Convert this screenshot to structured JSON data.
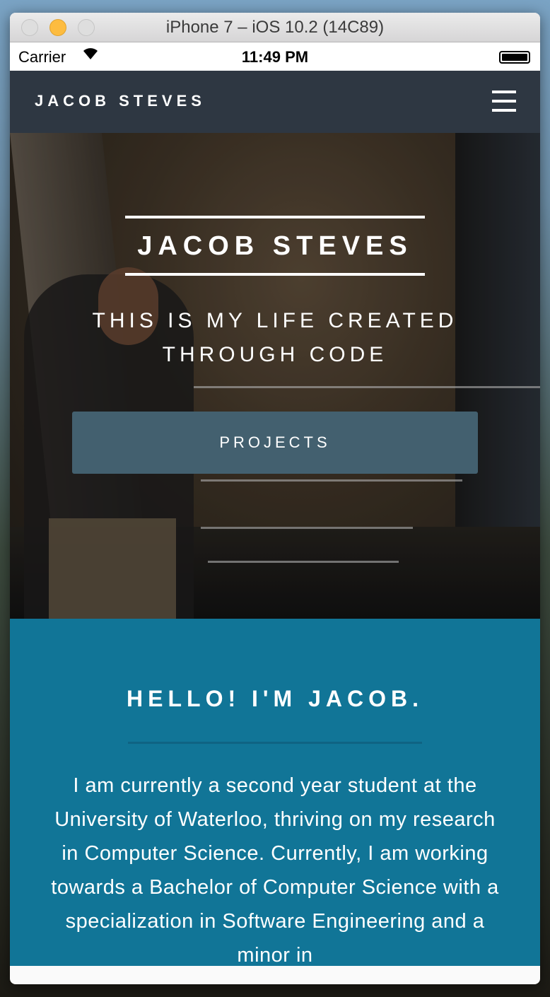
{
  "window": {
    "title": "iPhone 7 – iOS 10.2 (14C89)",
    "traffic_lights": [
      "#dcdcdc",
      "#fdbc40",
      "#dcdcdc"
    ]
  },
  "status_bar": {
    "carrier": "Carrier",
    "wifi_icon": "wifi-icon",
    "time": "11:49 PM",
    "battery_icon": "battery-icon"
  },
  "navbar": {
    "brand": "JACOB STEVES",
    "menu_icon": "hamburger-icon"
  },
  "hero": {
    "title": "JACOB STEVES",
    "tagline": "THIS IS MY LIFE CREATED THROUGH CODE",
    "button": "PROJECTS"
  },
  "about": {
    "heading": "HELLO! I'M JACOB.",
    "body": "I am currently a second year student at the University of Waterloo, thriving on my research in Computer Science. Currently, I am working towards a Bachelor of Computer Science with a specialization in Software Engineering and a minor in"
  },
  "colors": {
    "nav": "#2e3742",
    "button": "#43606f",
    "about": "#117597"
  }
}
